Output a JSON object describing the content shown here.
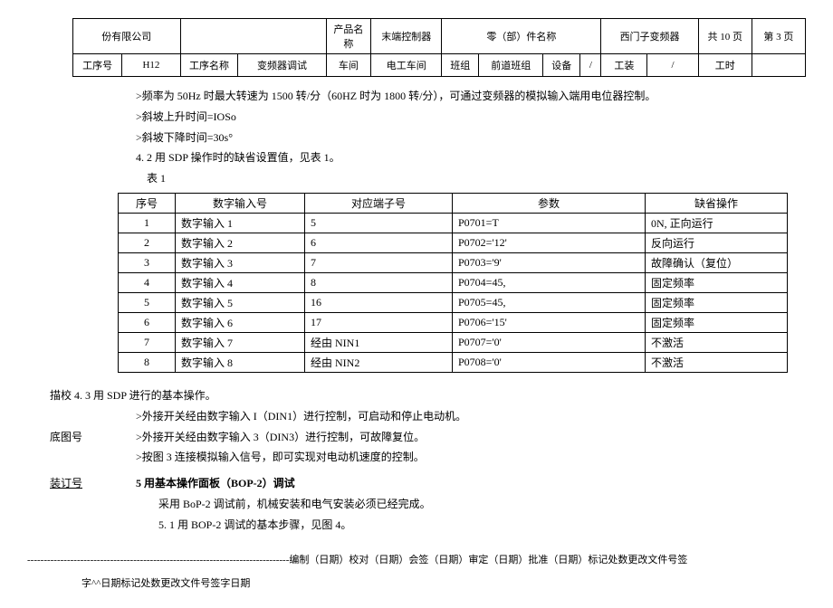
{
  "header": {
    "company": "份有限公司",
    "prodNameLabel": "产品名称",
    "prodName": "末端控制器",
    "partNameLabel": "零（部）件名称",
    "partName": "西门子变频器",
    "pagesTotal": "共 10 页",
    "pageCurrent": "第 3 页",
    "procNoLabel": "工序号",
    "procNo": "H12",
    "procNameLabel": "工序名称",
    "procName": "变频器调试",
    "workshopLabel": "车间",
    "workshop": "电工车间",
    "teamLabel": "班组",
    "team": "前道班组",
    "equipLabel": "设备",
    "equip": "/",
    "toolLabel": "工装",
    "tool": "/",
    "hoursLabel": "工时",
    "hours": ""
  },
  "body": {
    "l1": ">频率为 50Hz 时最大转速为 1500 转/分（60HZ 时为 1800 转/分），可通过变频器的模拟输入端用电位器控制。",
    "l2": ">斜坡上升时间=IOSo",
    "l3": ">斜坡下降时间=30s°",
    "l4": "4. 2 用 SDP 操作时的缺省设置值，见表 1。",
    "l5": "表 1"
  },
  "tableHead": {
    "h1": "序号",
    "h2": "数字输入号",
    "h3": "对应端子号",
    "h4": "参数",
    "h5": "缺省操作"
  },
  "rows": [
    {
      "no": "1",
      "din": "数字输入 1",
      "term": "5",
      "param": "P0701=T",
      "op": "0N, 正向运行"
    },
    {
      "no": "2",
      "din": "数字输入 2",
      "term": "6",
      "param": "P0702='12'",
      "op": "反向运行"
    },
    {
      "no": "3",
      "din": "数字输入 3",
      "term": "7",
      "param": "P0703='9'",
      "op": "故障确认（复位）"
    },
    {
      "no": "4",
      "din": "数字输入 4",
      "term": "8",
      "param": "P0704=45,",
      "op": "固定频率"
    },
    {
      "no": "5",
      "din": "数字输入 5",
      "term": "16",
      "param": "P0705=45,",
      "op": "固定频率"
    },
    {
      "no": "6",
      "din": "数字输入 6",
      "term": "17",
      "param": "P0706='15'",
      "op": "固定频率"
    },
    {
      "no": "7",
      "din": "数字输入 7",
      "term": "经由 NIN1",
      "param": "P0707='0'",
      "op": "不激活"
    },
    {
      "no": "8",
      "din": "数字输入 8",
      "term": "经由 NIN2",
      "param": "P0708='0'",
      "op": "不激活"
    }
  ],
  "below": {
    "desc": "描校 4. 3 用 SDP 进行的基本操作。",
    "b1": ">外接开关经由数字输入 I（DIN1）进行控制，可启动和停止电动机。",
    "leftLabel": "底图号",
    "b2": ">外接开关经由数字输入 3（DIN3）进行控制，可故障复位。",
    "b3": ">按图 3 连接模拟输入信号，即可实现对电动机速度的控制。",
    "bindLabel": "装订号",
    "sec5": "5 用基本操作面板（BOP-2）调试",
    "s1": "采用 BoP-2 调试前，机械安装和电气安装必须已经完成。",
    "s2": "5. 1 用 BOP-2 调试的基本步骤，见图 4。"
  },
  "footer": {
    "dashLine": "-------------------------------------------------------------------------------编制（日期）校对（日期）会签（日期）审定（日期）批准（日期）标记处数更改文件号签",
    "bottom": "字^^日期标记处数更改文件号签字日期"
  }
}
